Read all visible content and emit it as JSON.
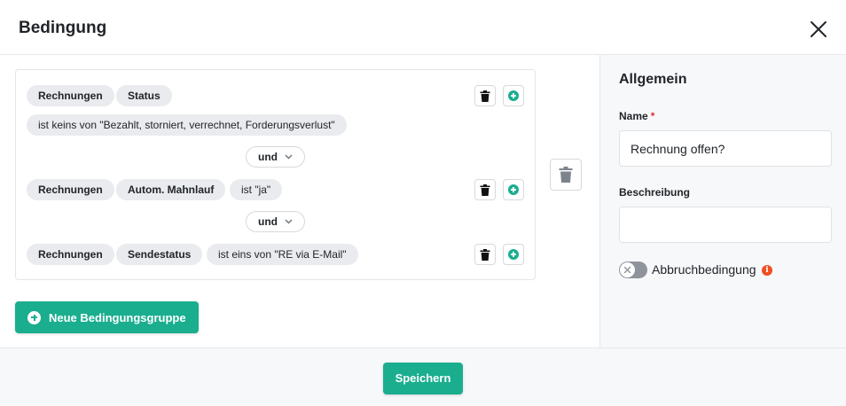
{
  "dialog": {
    "title": "Bedingung",
    "close_icon": "close-icon"
  },
  "conditions": [
    {
      "pills": [
        "Rechnungen",
        "Status"
      ],
      "value": "ist keins von \"Bezahlt, storniert, verrechnet, Forderungsverlust\""
    },
    {
      "pills": [
        "Rechnungen",
        "Autom. Mahnlauf"
      ],
      "value": "ist \"ja\""
    },
    {
      "pills": [
        "Rechnungen",
        "Sendestatus"
      ],
      "value": "ist eins von \"RE via E-Mail\""
    }
  ],
  "operators": [
    "und",
    "und"
  ],
  "buttons": {
    "new_group": "Neue Bedingungsgruppe",
    "save": "Speichern"
  },
  "sidebar": {
    "title": "Allgemein",
    "name_label": "Name",
    "name_required_mark": "*",
    "name_value": "Rechnung offen?",
    "description_label": "Beschreibung",
    "description_value": "",
    "abort_label": "Abbruchbedingung",
    "abort_enabled": false,
    "info_icon": "info-icon"
  },
  "colors": {
    "accent": "#1aae8f",
    "required": "#e03131",
    "info": "#f04e23"
  }
}
